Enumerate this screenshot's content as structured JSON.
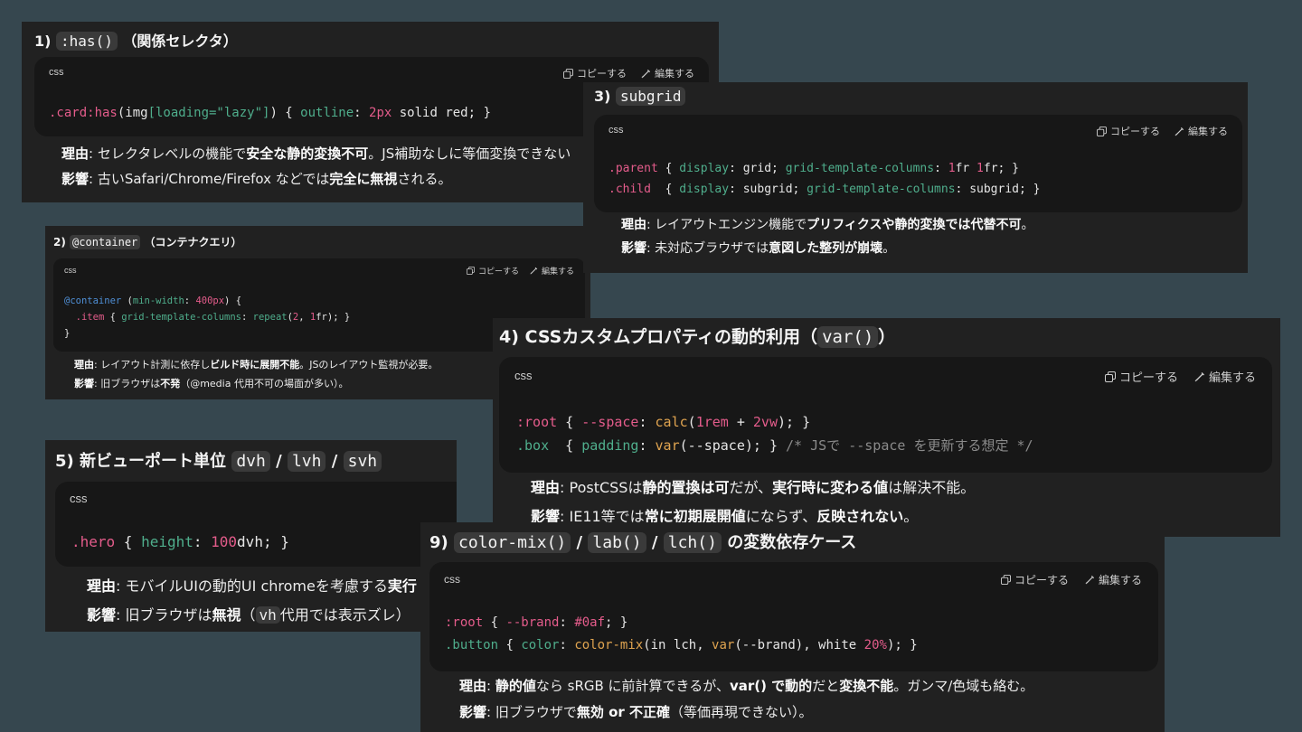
{
  "labels": {
    "copy": "コピーする",
    "edit": "編集する",
    "lang": "css"
  },
  "c1": {
    "num": "1)",
    "code": ":has()",
    "rest": "（関係セレクタ）",
    "reason_label": "理由",
    "reason_a": ": セレクタレベルの機能で",
    "reason_b": "安全な静的変換不可",
    "reason_c": "。JS補助なしに等価変換できない",
    "impact_label": "影響",
    "impact_a": ": 古いSafari/Chrome/Firefox などでは",
    "impact_b": "完全に無視",
    "impact_c": "される。"
  },
  "c2": {
    "num": "2)",
    "code": "@container",
    "rest": "（コンテナクエリ）",
    "reason_label": "理由",
    "reason_a": ": レイアウト計測に依存し",
    "reason_b": "ビルド時に展開不能",
    "reason_c": "。JSのレイアウト監視が必要。",
    "impact_label": "影響",
    "impact_a": ": 旧ブラウザは",
    "impact_b": "不発",
    "impact_c": "（@media 代用不可の場面が多い）。"
  },
  "c3": {
    "num": "3)",
    "code": "subgrid",
    "reason_label": "理由",
    "reason_a": ": レイアウトエンジン機能で",
    "reason_b": "プリフィクスや静的変換では代替不可",
    "reason_c": "。",
    "impact_label": "影響",
    "impact_a": ": 未対応ブラウザでは",
    "impact_b": "意図した整列が崩壊",
    "impact_c": "。"
  },
  "c4": {
    "title_a": "4) CSSカスタムプロパティの動的利用（",
    "code": "var()",
    "title_b": "）",
    "reason_label": "理由",
    "reason_a": ": PostCSSは",
    "reason_b": "静的置換は可",
    "reason_c": "だが、",
    "reason_d": "実行時に変わる値",
    "reason_e": "は解決不能。",
    "impact_label": "影響",
    "impact_a": ": IE11等では",
    "impact_b": "常に初期展開値",
    "impact_c": "にならず、",
    "impact_d": "反映されない",
    "impact_e": "。"
  },
  "c5": {
    "title": "5) 新ビューポート単位",
    "code1": "dvh",
    "code2": "lvh",
    "code3": "svh",
    "slash": "/",
    "reason_label": "理由",
    "reason_a": ": モバイルUIの動的UI chromeを考慮する",
    "reason_b": "実行",
    "impact_label": "影響",
    "impact_a": ": 旧ブラウザは",
    "impact_b": "無視",
    "impact_c": "（",
    "impact_code": "vh",
    "impact_d": "代用では表示ズレ）"
  },
  "c9": {
    "num": "9)",
    "code1": "color-mix()",
    "code2": "lab()",
    "code3": "lch()",
    "slash": "/",
    "rest": "の変数依存ケース",
    "reason_label": "理由",
    "reason_a": ": ",
    "reason_b": "静的値",
    "reason_c": "なら sRGB に前計算できるが、",
    "reason_d": "var() で動的",
    "reason_e": "だと",
    "reason_f": "変換不能",
    "reason_g": "。ガンマ/色域も絡む。",
    "impact_label": "影響",
    "impact_a": ": 旧ブラウザで",
    "impact_b": "無効 or 不正確",
    "impact_c": "（等価再現できない）。"
  },
  "icons": [
    "copy-icon",
    "edit-icon"
  ]
}
